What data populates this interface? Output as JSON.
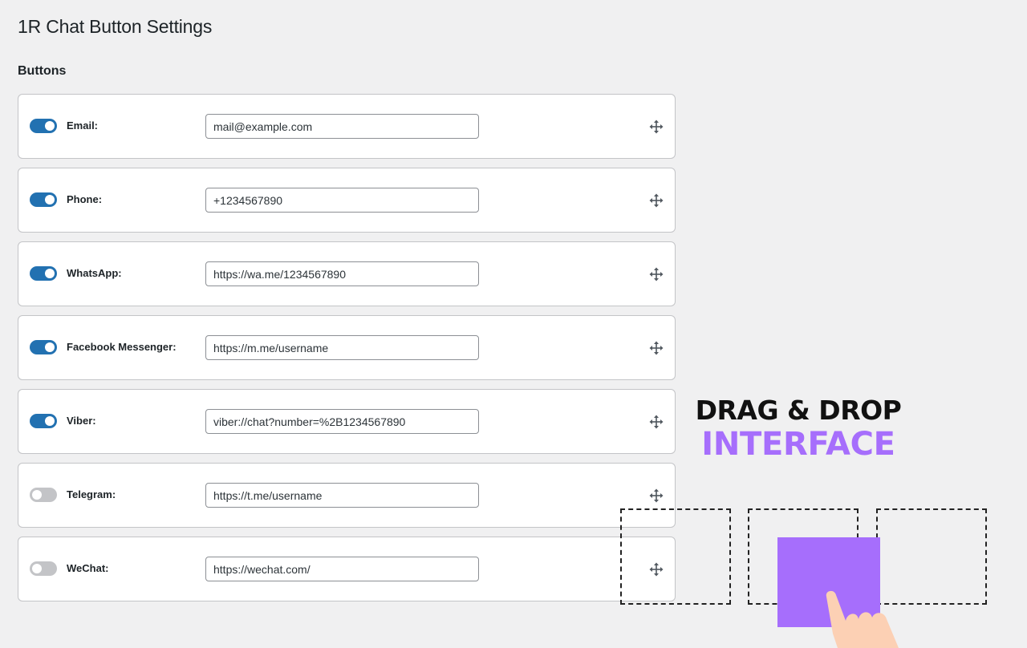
{
  "page": {
    "title": "1R Chat Button Settings",
    "section_title": "Buttons"
  },
  "buttons": [
    {
      "label": "Email:",
      "value": "mail@example.com",
      "enabled": true
    },
    {
      "label": "Phone:",
      "value": "+1234567890",
      "enabled": true
    },
    {
      "label": "WhatsApp:",
      "value": "https://wa.me/1234567890",
      "enabled": true
    },
    {
      "label": "Facebook Messenger:",
      "value": "https://m.me/username",
      "enabled": true
    },
    {
      "label": "Viber:",
      "value": "viber://chat?number=%2B1234567890",
      "enabled": true
    },
    {
      "label": "Telegram:",
      "value": "https://t.me/username",
      "enabled": false
    },
    {
      "label": "WeChat:",
      "value": "https://wechat.com/",
      "enabled": false
    }
  ],
  "icons": {
    "drag_handle": "move-arrows-icon"
  },
  "promo": {
    "line1": "DRAG & DROP",
    "line2": "INTERFACE"
  },
  "colors": {
    "toggle_on": "#2271b1",
    "toggle_off": "#c3c4c7",
    "accent_purple": "#a66efc",
    "background": "#f0f0f1"
  }
}
